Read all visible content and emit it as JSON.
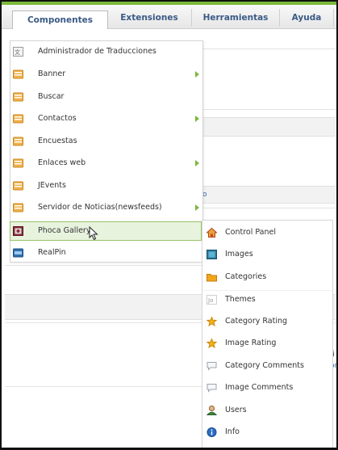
{
  "menubar": {
    "tabs": [
      {
        "label": "Componentes",
        "active": true
      },
      {
        "label": "Extensiones",
        "active": false
      },
      {
        "label": "Herramientas",
        "active": false
      },
      {
        "label": "Ayuda",
        "active": false
      }
    ]
  },
  "menu": {
    "items": [
      {
        "label": "Administrador de Traducciones",
        "icon": "translation-icon",
        "submenu": false
      },
      {
        "label": "Banner",
        "icon": "component-icon",
        "submenu": true
      },
      {
        "label": "Buscar",
        "icon": "component-icon",
        "submenu": false
      },
      {
        "label": "Contactos",
        "icon": "component-icon",
        "submenu": true
      },
      {
        "label": "Encuestas",
        "icon": "component-icon",
        "submenu": false
      },
      {
        "label": "Enlaces web",
        "icon": "component-icon",
        "submenu": true
      },
      {
        "label": "JEvents",
        "icon": "component-icon",
        "submenu": false
      },
      {
        "label": "Servidor de Noticias(newsfeeds)",
        "icon": "component-icon",
        "submenu": true
      },
      {
        "label": "Phoca Gallery",
        "icon": "phoca-gallery-icon",
        "submenu": true,
        "highlighted": true
      },
      {
        "label": "RealPin",
        "icon": "realpin-icon",
        "submenu": false
      }
    ]
  },
  "submenu": {
    "items": [
      {
        "label": "Control Panel",
        "icon": "control-panel-icon"
      },
      {
        "label": "Images",
        "icon": "images-icon"
      },
      {
        "label": "Categories",
        "icon": "folder-icon"
      },
      {
        "label": "Themes",
        "icon": "themes-icon"
      },
      {
        "label": "Category Rating",
        "icon": "category-rating-icon"
      },
      {
        "label": "Image Rating",
        "icon": "image-rating-icon"
      },
      {
        "label": "Category Comments",
        "icon": "category-comments-icon"
      },
      {
        "label": "Image Comments",
        "icon": "image-comments-icon"
      },
      {
        "label": "Users",
        "icon": "users-icon"
      },
      {
        "label": "Info",
        "icon": "info-icon"
      }
    ]
  },
  "background": {
    "fragment_1": "o",
    "fragment_2": "fi",
    "fragment_3": "or"
  },
  "colors": {
    "accent_green": "#7db83a",
    "highlight_bg": "#e8f3de",
    "tab_text": "#3a5a86"
  }
}
